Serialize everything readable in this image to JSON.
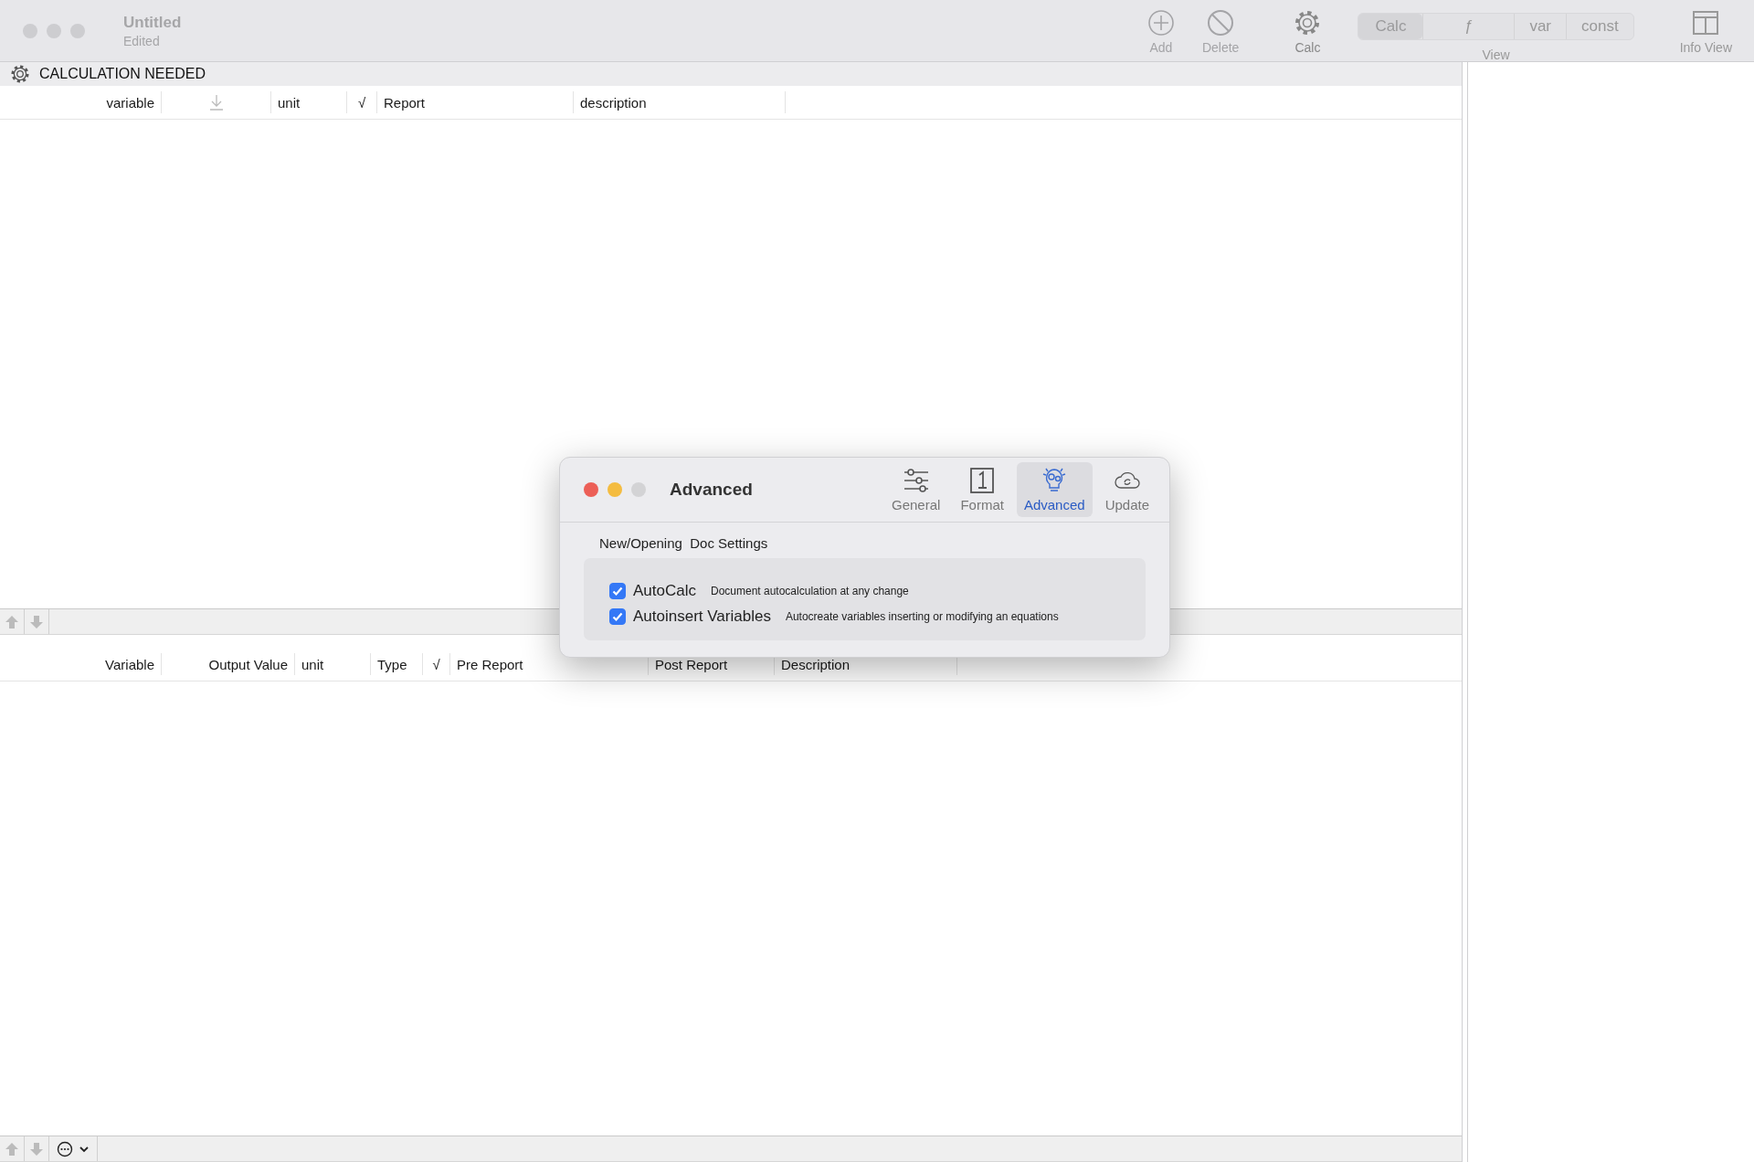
{
  "window": {
    "title": "Untitled",
    "subtitle": "Edited"
  },
  "toolbar": {
    "items": [
      {
        "label": "Add",
        "kind": "add",
        "disabled": true
      },
      {
        "label": "Delete",
        "kind": "delete",
        "disabled": true
      },
      {
        "label": "Calc",
        "kind": "calc",
        "disabled": false
      }
    ],
    "view": {
      "label": "View",
      "segments": [
        {
          "label": "Calc",
          "selected": true
        },
        {
          "label": "ƒ",
          "selected": false
        },
        {
          "label": "var",
          "selected": false
        },
        {
          "label": "const",
          "selected": false
        }
      ]
    },
    "info_view": {
      "label": "Info View"
    }
  },
  "status": {
    "text": "CALCULATION NEEDED"
  },
  "upper_table": {
    "columns": [
      {
        "label": "variable"
      },
      {
        "kind": "sort-icon"
      },
      {
        "label": "unit"
      },
      {
        "label": "√"
      },
      {
        "label": "Report"
      },
      {
        "label": "description"
      }
    ]
  },
  "lower_table": {
    "columns": [
      {
        "label": "Variable"
      },
      {
        "label": "Output Value"
      },
      {
        "label": "unit"
      },
      {
        "label": "Type"
      },
      {
        "label": "√"
      },
      {
        "label": "Pre Report"
      },
      {
        "label": "Post Report"
      },
      {
        "label": "Description"
      }
    ]
  },
  "dialog": {
    "title": "Advanced",
    "tabs": [
      {
        "label": "General",
        "kind": "sliders",
        "selected": false
      },
      {
        "label": "Format",
        "kind": "number",
        "selected": false
      },
      {
        "label": "Advanced",
        "kind": "gears",
        "selected": true
      },
      {
        "label": "Update",
        "kind": "cloud",
        "selected": false
      }
    ],
    "section": "New/Opening  Doc Settings",
    "options": [
      {
        "label": "AutoCalc",
        "description": "Document autocalculation at any change",
        "checked": true
      },
      {
        "label": "Autoinsert Variables",
        "description": "Autocreate variables inserting or modifying an equations",
        "checked": true
      }
    ]
  }
}
